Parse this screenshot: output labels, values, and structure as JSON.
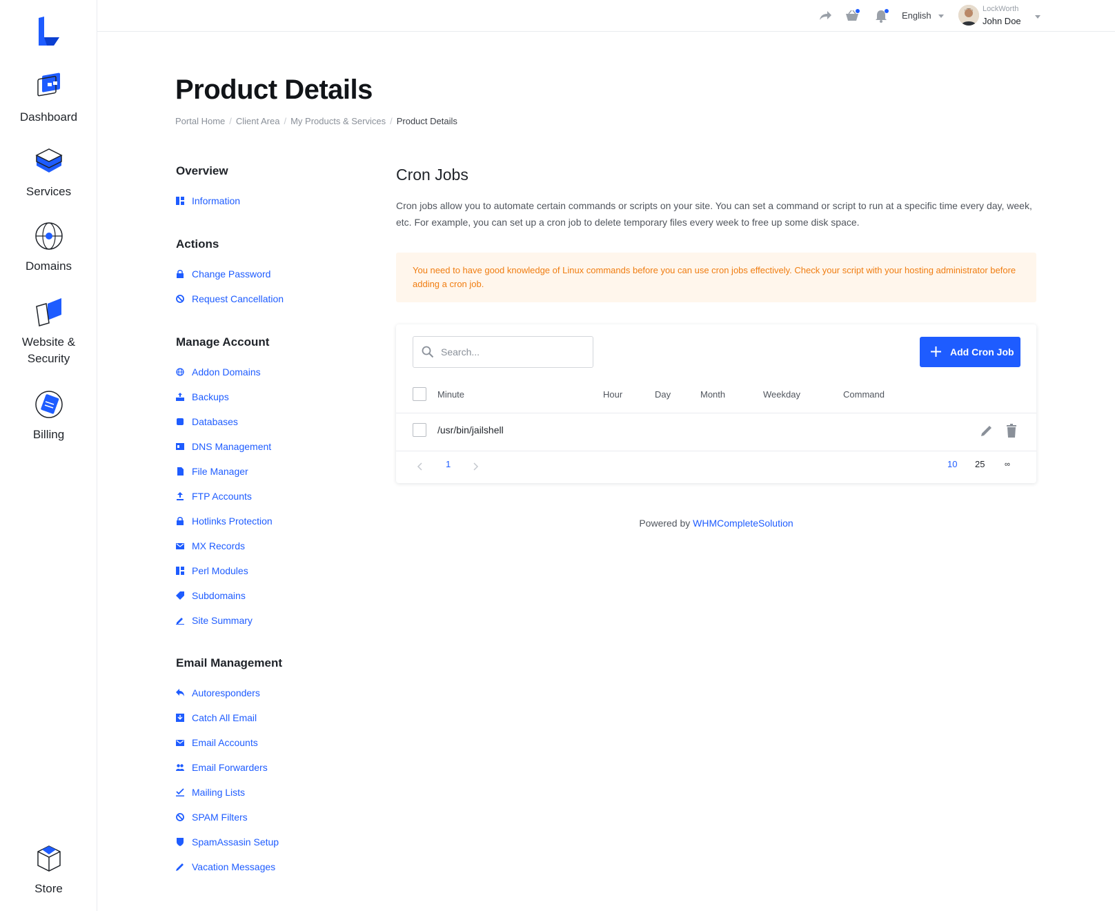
{
  "rail": {
    "items": [
      {
        "label": "Dashboard",
        "icon": "dashboard-icon"
      },
      {
        "label": "Services",
        "icon": "services-icon"
      },
      {
        "label": "Domains",
        "icon": "domains-icon"
      },
      {
        "label": "Website &",
        "label2": "Security",
        "icon": "website-security-icon"
      },
      {
        "label": "Billing",
        "icon": "billing-icon"
      }
    ],
    "store": {
      "label": "Store",
      "icon": "store-icon"
    }
  },
  "topbar": {
    "language": "English",
    "user": {
      "company": "LockWorth",
      "name": "John Doe"
    }
  },
  "page": {
    "title": "Product Details",
    "breadcrumb": [
      "Portal Home",
      "Client Area",
      "My Products & Services",
      "Product Details"
    ]
  },
  "subnav": {
    "overview": {
      "heading": "Overview",
      "items": [
        "Information"
      ]
    },
    "actions": {
      "heading": "Actions",
      "items": [
        "Change Password",
        "Request Cancellation"
      ]
    },
    "manage": {
      "heading": "Manage Account",
      "items": [
        "Addon Domains",
        "Backups",
        "Databases",
        "DNS Management",
        "File Manager",
        "FTP Accounts",
        "Hotlinks Protection",
        "MX Records",
        "Perl Modules",
        "Subdomains",
        "Site Summary"
      ]
    },
    "email": {
      "heading": "Email Management",
      "items": [
        "Autoresponders",
        "Catch All Email",
        "Email Accounts",
        "Email Forwarders",
        "Mailing Lists",
        "SPAM Filters",
        "SpamAssasin Setup",
        "Vacation Messages"
      ]
    }
  },
  "cron": {
    "title": "Cron Jobs",
    "description": "Cron jobs allow you to automate certain commands or scripts on your site. You can set a command or script to run at a specific time every day, week, etc. For example, you can set up a cron job to delete temporary files every week to free up some disk space.",
    "alert": "You need to have good knowledge of Linux commands before you can use cron jobs effectively. Check your script with your hosting administrator before adding a cron job.",
    "search_placeholder": "Search...",
    "add_button": "Add Cron Job",
    "columns": [
      "Minute",
      "Hour",
      "Day",
      "Month",
      "Weekday",
      "Command"
    ],
    "rows": [
      {
        "command": "/usr/bin/jailshell"
      }
    ],
    "pagination": {
      "current_page": "1",
      "page_sizes": [
        "10",
        "25",
        "∞"
      ],
      "active_size": "10"
    }
  },
  "footer": {
    "powered_prefix": "Powered by",
    "powered_link": "WHMCompleteSolution"
  },
  "colors": {
    "accent": "#1e5cff",
    "alert_bg": "#fff6ec",
    "alert_text": "#f07d11"
  }
}
